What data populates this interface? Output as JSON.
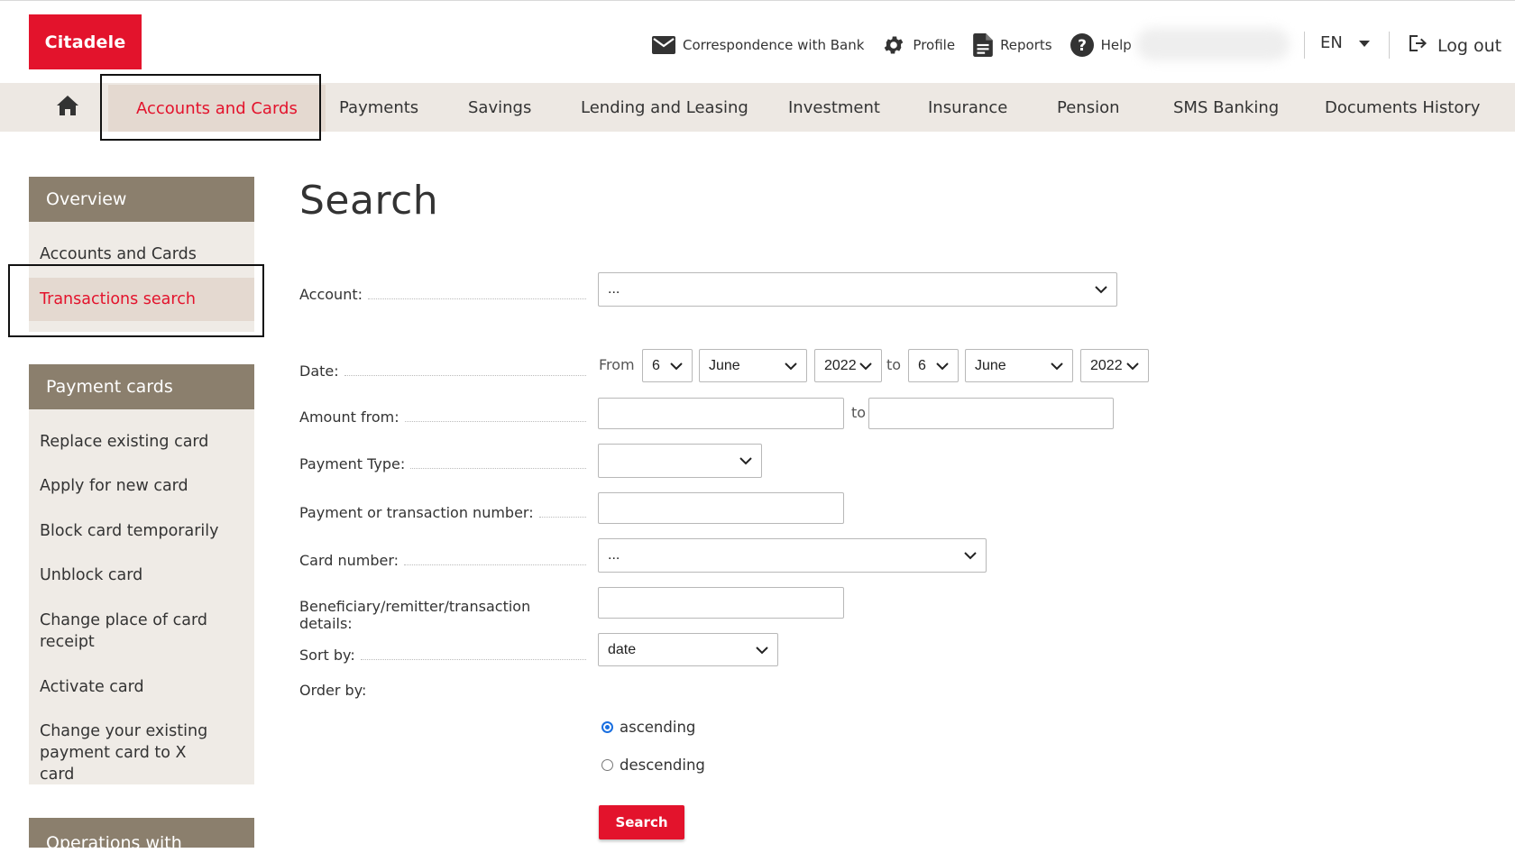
{
  "brand": {
    "logo_text": "Citadele",
    "accent": "#e3132c",
    "sidebar_head_color": "#8b7f6d"
  },
  "header": {
    "links": [
      {
        "label": "Correspondence with Bank",
        "icon": "envelope-icon"
      },
      {
        "label": "Profile",
        "icon": "gear-icon"
      },
      {
        "label": "Reports",
        "icon": "document-icon"
      },
      {
        "label": "Help",
        "icon": "help-icon"
      }
    ],
    "language": "EN",
    "logout": "Log out"
  },
  "nav": {
    "home_icon": "home-icon",
    "items": [
      "Accounts and Cards",
      "Payments",
      "Savings",
      "Lending and Leasing",
      "Investment",
      "Insurance",
      "Pension",
      "SMS Banking",
      "Documents History"
    ],
    "active": "Accounts and Cards"
  },
  "sidebar": {
    "sections": [
      {
        "title": "Overview",
        "items": [
          "Accounts and Cards",
          "Transactions search"
        ],
        "active": "Transactions search"
      },
      {
        "title": "Payment cards",
        "items": [
          "Replace existing card",
          "Apply for new card",
          "Block card temporarily",
          "Unblock card",
          "Change place of card receipt",
          "Activate card",
          "Change your existing payment card to X card"
        ]
      },
      {
        "title": "Operations with"
      }
    ]
  },
  "form": {
    "title": "Search",
    "account": {
      "label": "Account:",
      "value": "..."
    },
    "date": {
      "label": "Date:",
      "from_text": "From",
      "to_text": "to",
      "from_day": "6",
      "from_month": "June",
      "from_year": "2022",
      "to_day": "6",
      "to_month": "June",
      "to_year": "2022"
    },
    "amount": {
      "label": "Amount from:",
      "to_text": "to",
      "from_value": "",
      "to_value": ""
    },
    "payment_type": {
      "label": "Payment Type:",
      "value": ""
    },
    "transaction_number": {
      "label": "Payment or transaction number:",
      "value": ""
    },
    "card_number": {
      "label": "Card number:",
      "value": "..."
    },
    "details": {
      "label": "Beneficiary/remitter/transaction details:",
      "value": ""
    },
    "sort_by": {
      "label": "Sort by:",
      "value": "date"
    },
    "order_by": {
      "label": "Order by:",
      "options": [
        "ascending",
        "descending"
      ],
      "selected": "ascending"
    },
    "search_button": "Search"
  }
}
